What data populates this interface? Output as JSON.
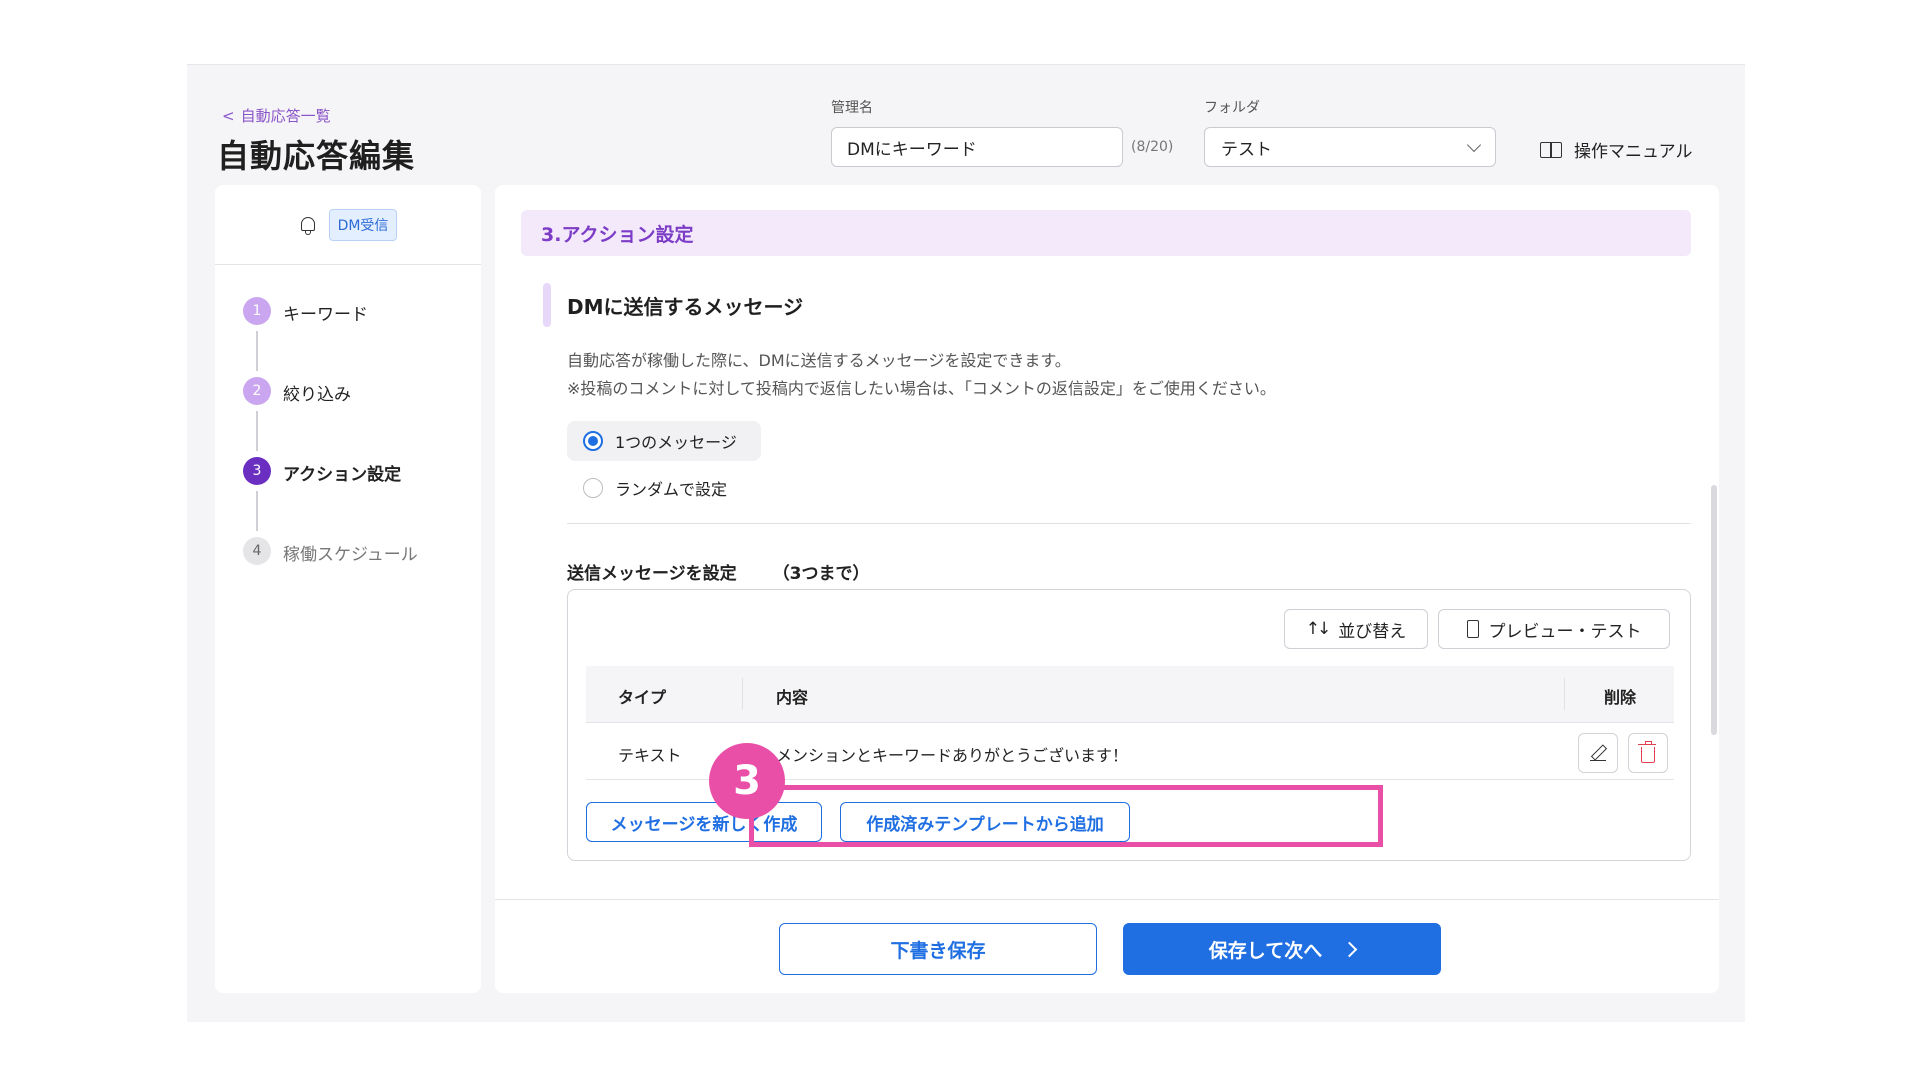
{
  "header": {
    "breadcrumb": "自動応答一覧",
    "title": "自動応答編集",
    "name_label": "管理名",
    "name_value": "DMにキーワード",
    "name_counter": "(8/20)",
    "folder_label": "フォルダ",
    "folder_value": "テスト",
    "manual_label": "操作マニュアル"
  },
  "sidebar": {
    "badge": "DM受信",
    "steps": [
      {
        "num": "1",
        "label": "キーワード",
        "state": "done"
      },
      {
        "num": "2",
        "label": "絞り込み",
        "state": "done"
      },
      {
        "num": "3",
        "label": "アクション設定",
        "state": "active"
      },
      {
        "num": "4",
        "label": "稼働スケジュール",
        "state": "todo"
      }
    ]
  },
  "main": {
    "section_title": "3.アクション設定",
    "sub_heading": "DMに送信するメッセージ",
    "desc1": "自動応答が稼働した際に、DMに送信するメッセージを設定できます。",
    "desc2": "※投稿のコメントに対して投稿内で返信したい場合は、「コメントの返信設定」をご使用ください。",
    "radio_single": "1つのメッセージ",
    "radio_random": "ランダムで設定",
    "send_title": "送信メッセージを設定",
    "send_limit": "（3つまで）",
    "sort_label": "並び替え",
    "preview_label": "プレビュー・テスト",
    "table": {
      "col_type": "タイプ",
      "col_content": "内容",
      "col_delete": "削除",
      "rows": [
        {
          "type": "テキスト",
          "content": "メンションとキーワードありがとうございます！"
        }
      ]
    },
    "new_message_label": "メッセージを新しく作成",
    "template_label": "作成済みテンプレートから追加",
    "draft_label": "下書き保存",
    "next_label": "保存して次へ"
  },
  "annotation": {
    "step_number": "3",
    "color": "#ea4fa8"
  },
  "colors": {
    "accent_blue": "#1f6fe3",
    "accent_purple": "#7c3cc6",
    "delete_red": "#e0434f"
  }
}
